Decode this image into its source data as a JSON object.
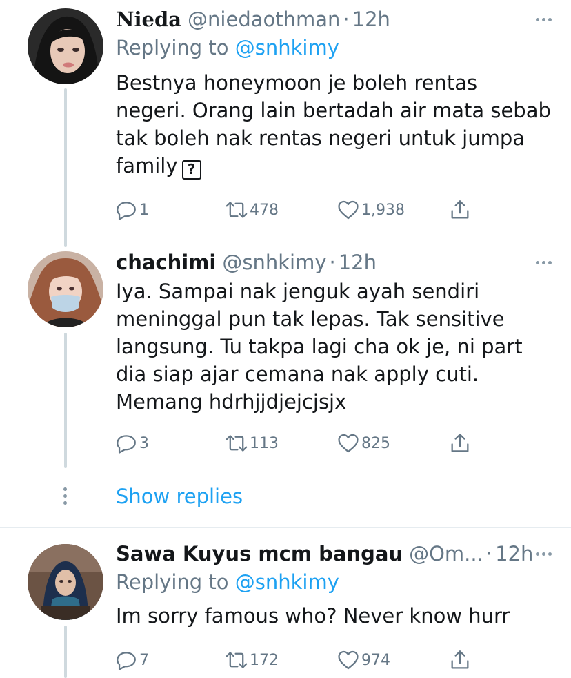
{
  "tweets": [
    {
      "name": "Nieda",
      "handle": "@niedaothman",
      "time": "12h",
      "replying_prefix": "Replying to ",
      "replying_to": "@snhkimy",
      "text": "Bestnya honeymoon je boleh rentas\nnegeri. Orang lain bertadah air mata sebab\ntak boleh nak rentas negeri untuk jumpa\nfamily",
      "emoji_placeholder": "?",
      "replies": "1",
      "retweets": "478",
      "likes": "1,938"
    },
    {
      "name": "chachimi",
      "handle": "@snhkimy",
      "time": "12h",
      "text": "Iya. Sampai nak jenguk ayah sendiri\nmeninggal pun tak lepas. Tak sensitive\nlangsung. Tu takpa lagi cha ok je, ni part\ndia siap ajar cemana nak apply cuti.\nMemang hdrhjjdjejcjsjx",
      "replies": "3",
      "retweets": "113",
      "likes": "825"
    },
    {
      "name": "Sawa Kuyus mcm bangau",
      "handle": "@Om...",
      "time": "12h",
      "replying_prefix": "Replying to ",
      "replying_to": "@snhkimy",
      "text": "Im sorry famous who? Never know hurr",
      "replies": "7",
      "retweets": "172",
      "likes": "974"
    }
  ],
  "show_replies": "Show replies",
  "separator": "·",
  "colors": {
    "accent": "#1da1f2",
    "secondary_text": "#657786",
    "thread_line": "#cfd9de"
  }
}
